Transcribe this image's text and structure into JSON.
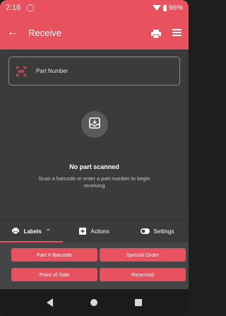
{
  "status_bar": {
    "time": "2:16",
    "battery_percent": "96%"
  },
  "app_bar": {
    "title": "Receive"
  },
  "part_field": {
    "placeholder": "Part Number"
  },
  "empty_state": {
    "title": "No part scanned",
    "subtitle": "Scan a barcode or enter a part number to begin receiving"
  },
  "tabs": [
    {
      "label": "Labels",
      "active": true
    },
    {
      "label": "Actions",
      "active": false
    },
    {
      "label": "Settings",
      "active": false
    }
  ],
  "label_buttons": [
    "Part # Barcode",
    "Special Order",
    "Point of Sale",
    "Reserved"
  ],
  "colors": {
    "accent": "#e8525e",
    "background": "#3b3b3b",
    "panel": "#454545"
  }
}
